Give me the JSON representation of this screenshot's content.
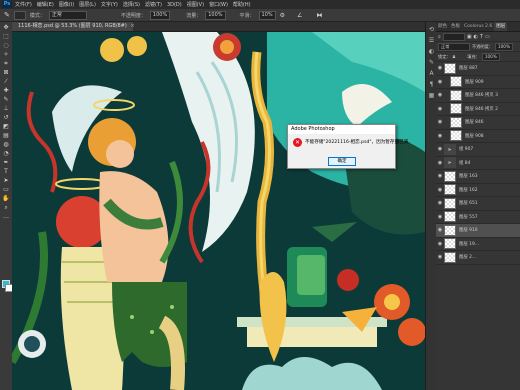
{
  "menubar": {
    "logo": "Ps",
    "items": [
      "文件(F)",
      "编辑(E)",
      "图像(I)",
      "图层(L)",
      "文字(Y)",
      "选择(S)",
      "滤镜(T)",
      "3D(D)",
      "视图(V)",
      "窗口(W)",
      "帮助(H)"
    ]
  },
  "options": {
    "mode_label": "模式：",
    "mode_value": "正常",
    "opacity_label": "不透明度：",
    "opacity_value": "100%",
    "flow_label": "流量：",
    "flow_value": "100%",
    "smooth_label": "平滑：",
    "smooth_value": "10%"
  },
  "document": {
    "tab_label": "1116-相恋.psd @ 53.3% (图层 910, RGB/8#)"
  },
  "dialog": {
    "title": "Adobe Photoshop",
    "message": "不能存储\"20221116-相恋.psd\"，因为暂存盘已满。",
    "ok_label": "确定",
    "error_symbol": "✕"
  },
  "panel": {
    "tabs": [
      "颜色",
      "色板",
      "Coolorus 2.6",
      "图层"
    ],
    "blend_mode": "正常",
    "opacity_label": "不透明度：",
    "opacity_value": "100%",
    "lock_label": "锁定：",
    "fill_label": "填充：",
    "fill_value": "100%",
    "layers": [
      {
        "name": "图层 887",
        "type": "layer",
        "selected": false
      },
      {
        "name": "图层 909",
        "type": "layer",
        "selected": false
      },
      {
        "name": "图层 846 拷贝 3",
        "type": "layer",
        "selected": false
      },
      {
        "name": "图层 846 拷贝 2",
        "type": "layer",
        "selected": false
      },
      {
        "name": "图层 846",
        "type": "layer",
        "selected": false
      },
      {
        "name": "图层 908",
        "type": "layer",
        "selected": false
      },
      {
        "name": "组 907",
        "type": "group",
        "selected": false
      },
      {
        "name": "组 84",
        "type": "group",
        "selected": false
      },
      {
        "name": "图层 163",
        "type": "layer",
        "selected": false
      },
      {
        "name": "图层 162",
        "type": "layer",
        "selected": false
      },
      {
        "name": "图层 651",
        "type": "layer",
        "selected": false
      },
      {
        "name": "图层 557",
        "type": "layer",
        "selected": false
      },
      {
        "name": "图层 910",
        "type": "layer",
        "selected": true
      },
      {
        "name": "图层 19...",
        "type": "layer",
        "selected": false
      },
      {
        "name": "图层 2...",
        "type": "layer",
        "selected": false
      }
    ]
  },
  "colors": {
    "foreground": "#22c3d9",
    "background": "#ffffff",
    "canvas_bg": "#0b3b39"
  }
}
